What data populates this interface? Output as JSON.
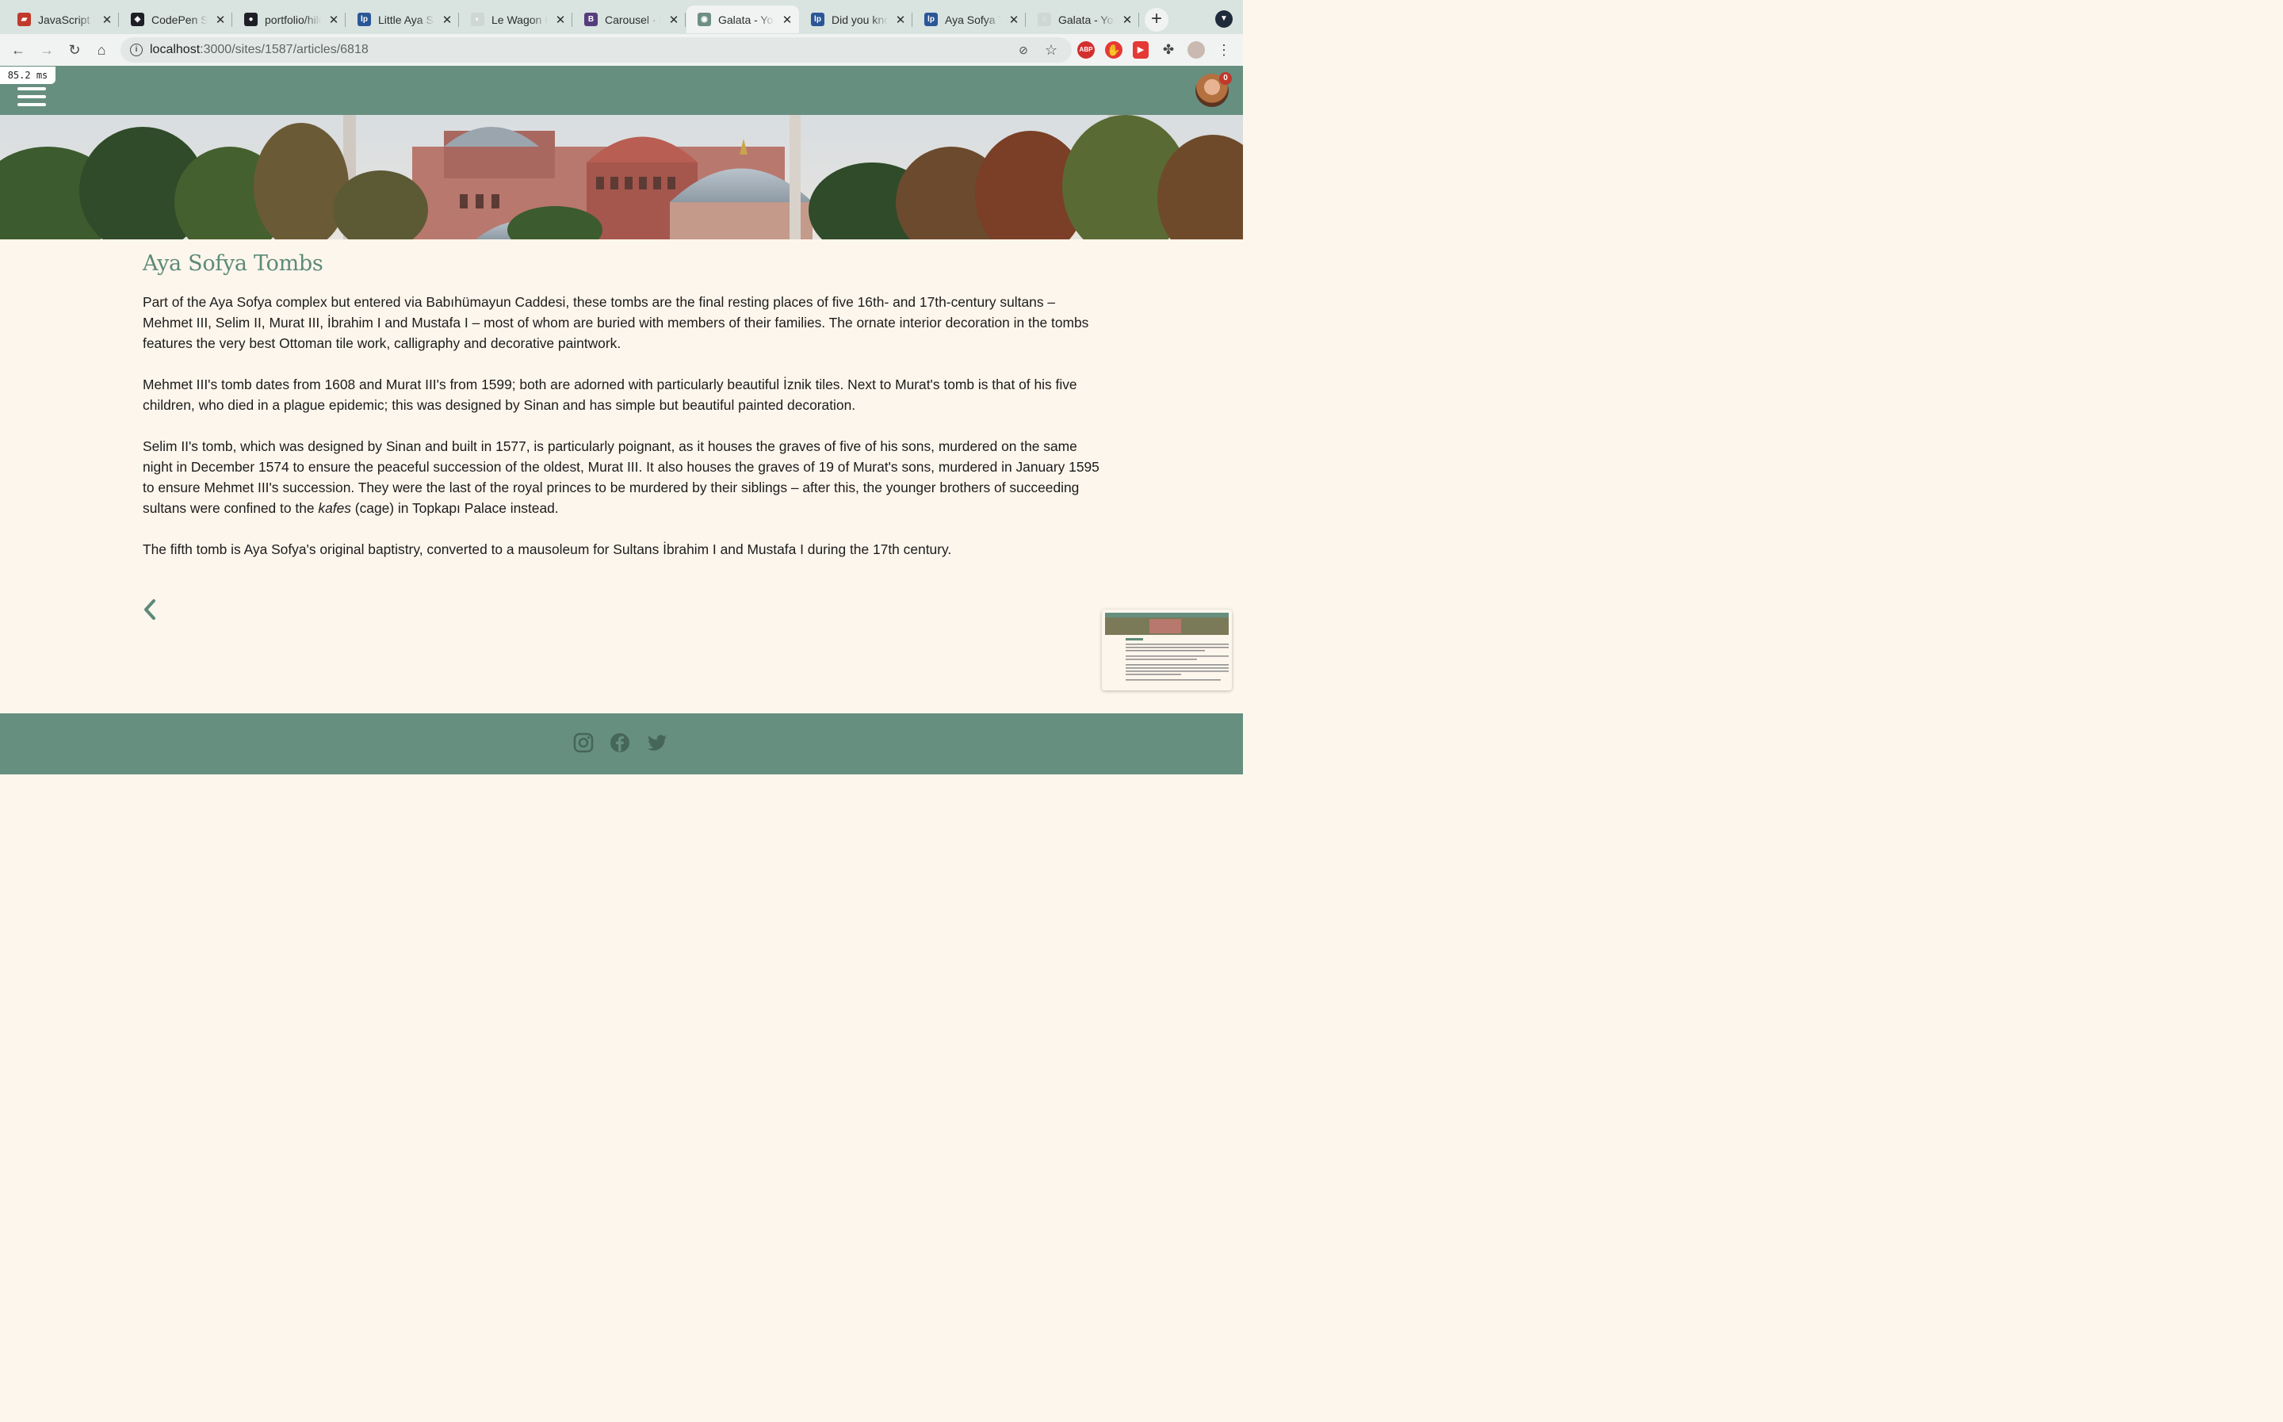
{
  "browser": {
    "tabs": [
      {
        "title": "JavaScript Basics",
        "favicon": "le-wagon-icon",
        "color": "#c0392b",
        "glyph": "▰"
      },
      {
        "title": "CodePen Search",
        "favicon": "codepen-icon",
        "color": "#1e1f26",
        "glyph": "◈"
      },
      {
        "title": "portfolio/hilde",
        "favicon": "github-icon",
        "color": "#1e1f26",
        "glyph": "●"
      },
      {
        "title": "Little Aya Sofya",
        "favicon": "lonely-planet-icon",
        "color": "#2b5797",
        "glyph": "lp"
      },
      {
        "title": "Le Wagon UI",
        "favicon": "le-wagon-ui-icon",
        "color": "#cfd7d4",
        "glyph": "◐"
      },
      {
        "title": "Carousel · Bootstrap",
        "favicon": "bootstrap-icon",
        "color": "#563d7c",
        "glyph": "B"
      },
      {
        "title": "Galata - Your Guide",
        "favicon": "galata-icon",
        "color": "#6e8f82",
        "glyph": "◉",
        "active": true
      },
      {
        "title": "Did you know",
        "favicon": "lonely-planet-icon",
        "color": "#2b5797",
        "glyph": "lp"
      },
      {
        "title": "Aya Sofya Tombs",
        "favicon": "lonely-planet-icon",
        "color": "#2b5797",
        "glyph": "lp"
      },
      {
        "title": "Galata - Your Guide",
        "favicon": "loading-icon",
        "color": "#cfd7d4",
        "glyph": "◌"
      }
    ],
    "new_tab": "+",
    "url_host": "localhost",
    "url_path": ":3000/sites/1587/articles/6818"
  },
  "page": {
    "timing_badge": "85.2 ms",
    "notification_count": "0",
    "article": {
      "title": "Aya Sofya Tombs",
      "p1": "Part of the Aya Sofya complex but entered via Babıhümayun Caddesi, these tombs are the final resting places of five 16th- and 17th-century sultans – Mehmet III, Selim II, Murat III, İbrahim I and Mustafa I – most of whom are buried with members of their families. The ornate interior decoration in the tombs features the very best Ottoman tile work, calligraphy and decorative paintwork.",
      "p2": "Mehmet III's tomb dates from 1608 and Murat III's from 1599; both are adorned with particularly beautiful İznik tiles. Next to Murat's tomb is that of his five children, who died in a plague epidemic; this was designed by Sinan and has simple but beautiful painted decoration.",
      "p3_before": "Selim II's tomb, which was designed by Sinan and built in 1577, is particularly poignant, as it houses the graves of five of his sons, murdered on the same night in December 1574 to ensure the peaceful succession of the oldest, Murat III. It also houses the graves of 19 of Murat's sons, murdered in January 1595 to ensure Mehmet III's succession. They were the last of the royal princes to be murdered by their siblings – after this, the younger brothers of succeeding sultans were confined to the ",
      "p3_em": "kafes",
      "p3_after": " (cage) in Topkapı Palace instead.",
      "p4": "The fifth tomb is Aya Sofya's original baptistry, converted to a mausoleum for Sultans İbrahim I and Mustafa I during the 17th century."
    },
    "footer_icons": [
      "instagram-icon",
      "facebook-icon",
      "twitter-icon"
    ]
  },
  "colors": {
    "brand_green": "#668f7f",
    "title_green": "#5d8a78",
    "page_bg": "#fdf6ec"
  }
}
